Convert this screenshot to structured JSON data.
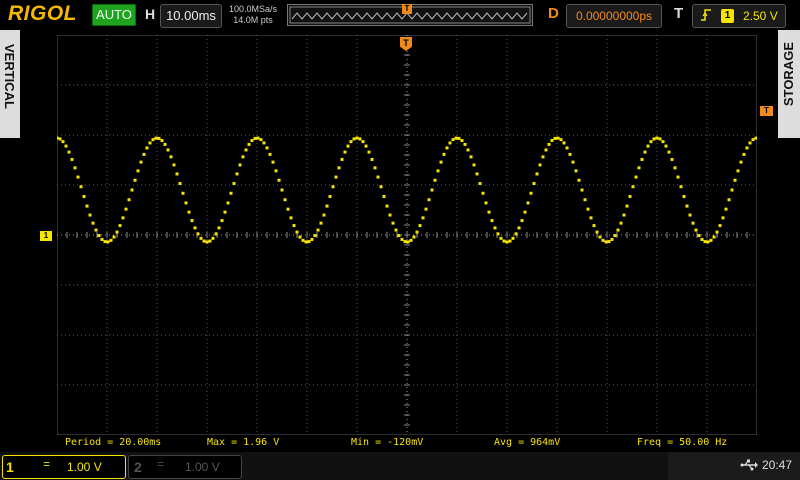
{
  "brand": "RIGOL",
  "run_status": "AUTO",
  "horizontal": {
    "label": "H",
    "timebase": "10.00ms"
  },
  "sample": {
    "rate": "100.0MSa/s",
    "points": "14.0M pts"
  },
  "trigger_marker": "T",
  "delay": {
    "label": "D",
    "value": "0.00000000ps"
  },
  "trigger": {
    "label": "T",
    "source": "1",
    "level": "2.50 V",
    "edge_icon": "rising-edge-icon"
  },
  "side_tabs": {
    "left": "VERTICAL",
    "right": "STORAGE"
  },
  "channel_marker": "1",
  "trigger_level_marker": "T",
  "measurements": {
    "period": "Period = 20.00ms",
    "max": "Max = 1.96 V",
    "min": "Min = -120mV",
    "avg": "Avg = 964mV",
    "freq": "Freq = 50.00 Hz"
  },
  "channels": [
    {
      "num": "1",
      "coupling": "=",
      "scale": "1.00 V",
      "active": true,
      "color": "#f5e400"
    },
    {
      "num": "2",
      "coupling": "=",
      "scale": "1.00 V",
      "active": false,
      "color": "#555555"
    }
  ],
  "status": {
    "clock": "20:47",
    "usb_icon": "usb-icon"
  },
  "waveform": {
    "frequency_hz": 50,
    "max_v": 1.96,
    "min_v": -0.12,
    "volts_per_div": 1.0,
    "time_per_div_ms": 10.0,
    "color": "#f5e400"
  },
  "colors": {
    "brand": "#f5b800",
    "trigger": "#f08a1a",
    "ch1": "#f5e400",
    "run": "#1fa31f"
  }
}
